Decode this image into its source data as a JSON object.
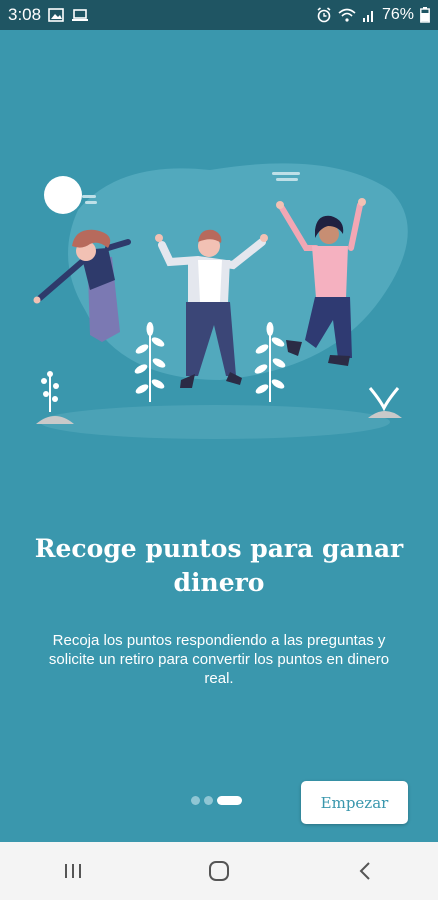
{
  "status_bar": {
    "time": "3:08",
    "battery_percent": "76%",
    "left_icons": [
      "image-icon",
      "laptop-icon"
    ],
    "right_icons": [
      "alarm-icon",
      "wifi-icon",
      "signal-icon",
      "battery-icon"
    ]
  },
  "onboarding": {
    "title_line1": "Recoge puntos para ganar",
    "title_line2": "dinero",
    "body_line1": "Recoja los puntos respondiendo a las preguntas y",
    "body_line2": "solicite un retiro para convertir los puntos en dinero",
    "body_line3": "real.",
    "page_indicator": {
      "total": 3,
      "current": 3
    },
    "start_button": "Empezar"
  },
  "colors": {
    "background": "#3a97ad",
    "status_bar": "#1f5563",
    "nav_bar": "#f4f4f4",
    "accent": "#3a97ad"
  },
  "nav_bar": {
    "buttons": [
      "recent-apps-icon",
      "home-icon",
      "back-icon"
    ]
  }
}
